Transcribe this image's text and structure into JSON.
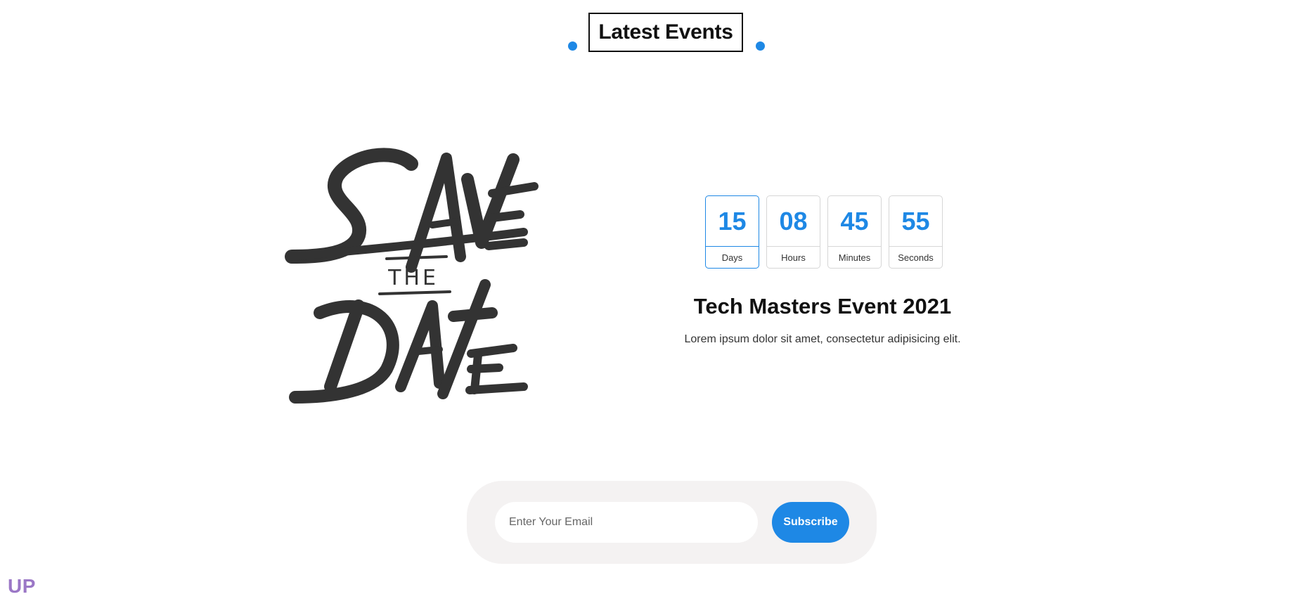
{
  "section": {
    "title": "Latest Events"
  },
  "save_the_date": {
    "line1": "SAVE",
    "line2": "THE",
    "line3": "DATE"
  },
  "countdown": [
    {
      "value": "15",
      "label": "Days"
    },
    {
      "value": "08",
      "label": "Hours"
    },
    {
      "value": "45",
      "label": "Minutes"
    },
    {
      "value": "55",
      "label": "Seconds"
    }
  ],
  "event": {
    "title": "Tech Masters Event 2021",
    "description": "Lorem ipsum dolor sit amet, consectetur adipisicing elit."
  },
  "subscribe": {
    "placeholder": "Enter Your Email",
    "button_label": "Subscribe"
  },
  "corner_logo": "UP",
  "colors": {
    "accent": "#1e88e5",
    "logo": "#9b77c6",
    "art": "#333333"
  }
}
